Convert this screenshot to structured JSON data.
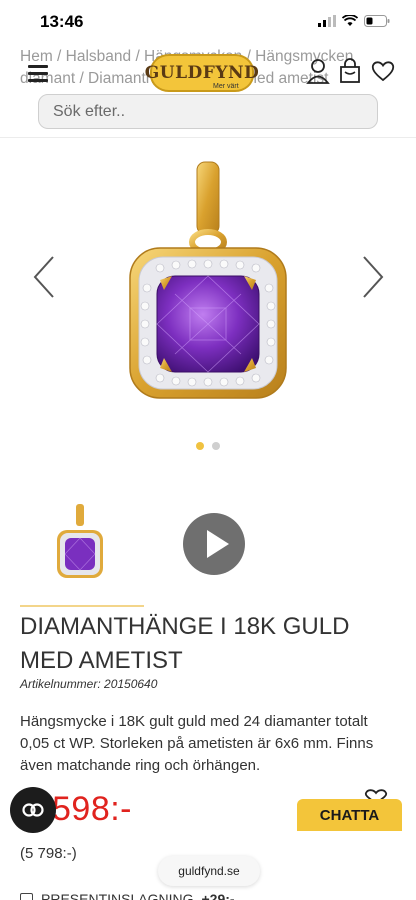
{
  "status": {
    "time": "13:46"
  },
  "breadcrumb": {
    "text": "Hem / Halsband / Hängsmycken / Hängsmycken diamant / Diamanthängen / guld med ametist"
  },
  "header": {
    "logo_text": "GULDFYND",
    "logo_sub": "Mer värt"
  },
  "search": {
    "placeholder": "Sök efter.."
  },
  "product": {
    "title": "DIAMANTHÄNGE I 18K GULD MED AMETIST",
    "article_label": "Artikelnummer: 20150640",
    "description": "Hängsmycke i 18K gult guld med 24 diamanter totalt 0,05 ct WP. Storleken på ametisten är 6x6 mm. Finns även matchande ring och örhängen.",
    "price": "598:-",
    "old_price": "(5 798:-)"
  },
  "chat": {
    "label": "CHATTA"
  },
  "browser": {
    "domain": "guldfynd.se"
  },
  "gift": {
    "label": "PRESENTINSLAGNING",
    "price": "+29:-"
  },
  "gallery": {
    "active_index": 0,
    "count": 2
  }
}
